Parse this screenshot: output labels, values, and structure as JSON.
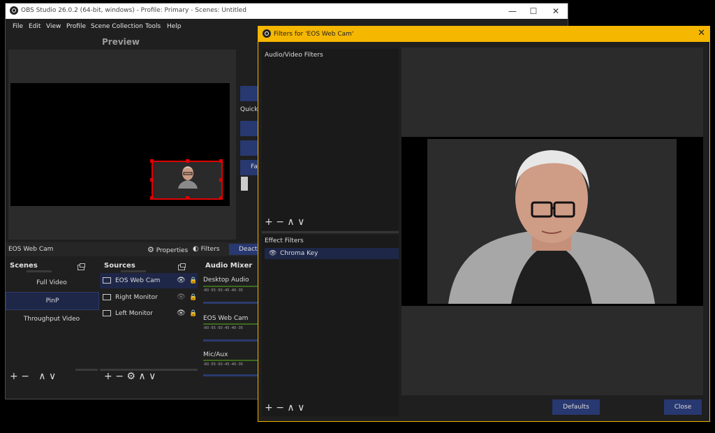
{
  "main_window": {
    "title": "OBS Studio 26.0.2 (64-bit, windows) - Profile: Primary - Scenes: Untitled",
    "menu": [
      "File",
      "Edit",
      "View",
      "Profile",
      "Scene Collection",
      "Tools",
      "Help"
    ],
    "preview_label": "Preview",
    "quick_label": "Quick",
    "transition_button_partial": "Fa",
    "current_source": "EOS Web Cam",
    "properties_label": "Properties",
    "filters_label": "Filters",
    "deactivate_partial": "Deact",
    "scenes": {
      "title": "Scenes",
      "items": [
        "Full Video",
        "PinP",
        "Throughput Video"
      ],
      "selected": "PinP"
    },
    "sources": {
      "title": "Sources",
      "items": [
        "EOS Web Cam",
        "Right Monitor",
        "Left Monitor"
      ],
      "selected": "EOS Web Cam"
    },
    "audio_mixer": {
      "title": "Audio Mixer",
      "channels": [
        "Desktop Audio",
        "EOS Web Cam",
        "Mic/Aux"
      ],
      "ticks": "-60 -55 -50 -45 -40 -35"
    },
    "controls": {
      "add": "+",
      "remove": "−",
      "up": "∧",
      "down": "∨",
      "gear": "⚙"
    }
  },
  "filters_dialog": {
    "title": "Filters for 'EOS Web Cam'",
    "audio_video_label": "Audio/Video Filters",
    "effect_label": "Effect Filters",
    "effect_filters": [
      "Chroma Key"
    ],
    "defaults_label": "Defaults",
    "close_label": "Close",
    "close_x": "✕"
  },
  "colors": {
    "accent_blue": "#283870",
    "dialog_border": "#f5b700",
    "selection_red": "#e00000"
  }
}
